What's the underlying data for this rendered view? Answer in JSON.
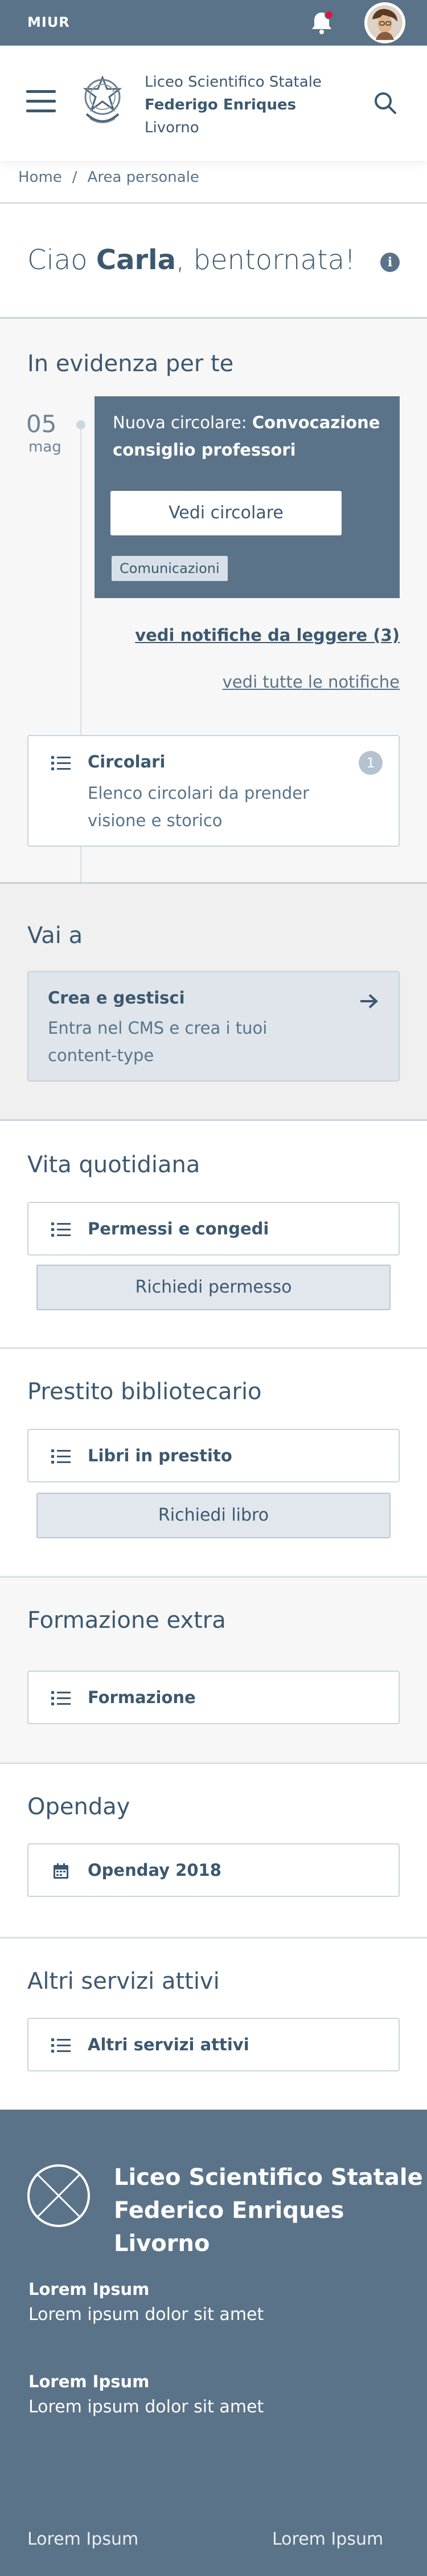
{
  "topbar": {
    "brand": "MIUR",
    "notifications_icon": "bell-icon",
    "has_unread": true,
    "avatar": "user-avatar"
  },
  "header": {
    "menu_icon": "hamburger-icon",
    "emblem": "republic-emblem-icon",
    "school_line1": "Liceo Scientifico Statale",
    "school_line2": "Federigo Enriques",
    "school_line3": "Livorno",
    "search_icon": "search-icon"
  },
  "breadcrumb": {
    "home": "Home",
    "separator": "/",
    "current": "Area personale"
  },
  "greeting": {
    "prefix": "Ciao ",
    "name": "Carla",
    "suffix": ", bentornata!",
    "info_icon": "info-icon",
    "info_glyph": "i"
  },
  "highlights": {
    "title": "In evidenza per te",
    "date_day": "05",
    "date_month": "mag",
    "notification": {
      "prefix": "Nuova circolare: ",
      "subject": "Convocazione consiglio professori",
      "button": "Vedi circolare",
      "tag": "Comunicazioni"
    },
    "link_unread": "vedi notifiche da leggere (3)",
    "link_all": "vedi tutte le notifiche",
    "circolari": {
      "title": "Circolari",
      "description": "Elenco circolari da prender visione e storico",
      "badge": "1",
      "icon": "list-icon"
    }
  },
  "vai_a": {
    "title": "Vai a",
    "card_title": "Crea e gestisci",
    "card_description": "Entra nel CMS e crea i tuoi content-type",
    "icon": "arrow-right-icon"
  },
  "sections": {
    "vita": {
      "title": "Vita quotidiana",
      "item": "Permessi e congedi",
      "action": "Richiedi permesso"
    },
    "prestito": {
      "title": "Prestito bibliotecario",
      "item": "Libri in prestito",
      "action": "Richiedi libro"
    },
    "formazione": {
      "title": "Formazione extra",
      "item": "Formazione"
    },
    "openday": {
      "title": "Openday",
      "item": "Openday 2018",
      "icon": "calendar-icon"
    },
    "altri": {
      "title": "Altri servizi attivi",
      "item": "Altri servizi attivi"
    }
  },
  "footer": {
    "logo": "placeholder-logo-icon",
    "name_line1": "Liceo Scientifico Statale",
    "name_line2": "Federico Enriques",
    "name_line3": "Livorno",
    "block1_title": "Lorem Ipsum",
    "block1_text": "Lorem ipsum dolor sit amet",
    "block2_title": "Lorem Ipsum",
    "block2_text": "Lorem ipsum dolor sit amet",
    "bottom_left": "Lorem Ipsum",
    "bottom_right": "Lorem Ipsum"
  },
  "colors": {
    "primary": "#5a7389",
    "text": "#3c5870",
    "notification_dot": "#e0153d",
    "section_bg": "#f7f7f7"
  }
}
